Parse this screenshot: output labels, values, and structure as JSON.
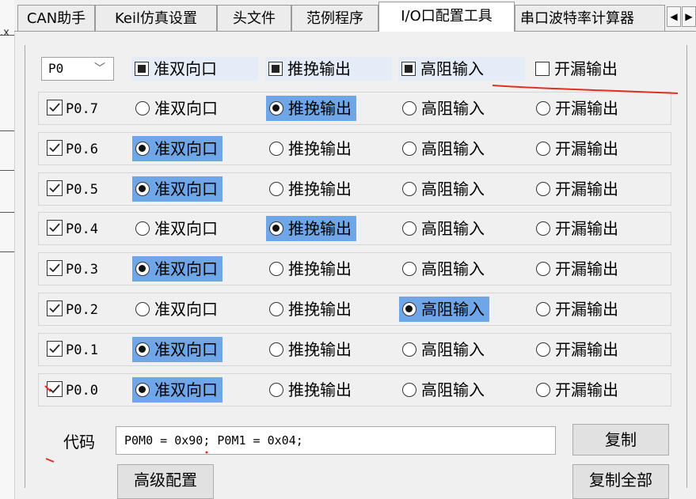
{
  "left_edge": {
    "fragment": ".x"
  },
  "tabs": [
    {
      "label": "CAN助手",
      "active": false
    },
    {
      "label": "Keil仿真设置",
      "active": false
    },
    {
      "label": "头文件",
      "active": false
    },
    {
      "label": "范例程序",
      "active": false
    },
    {
      "label": "I/O口配置工具",
      "active": true
    },
    {
      "label": "串口波特率计算器",
      "active": false
    }
  ],
  "tab_scroll": {
    "left_icon": "◀",
    "right_icon": "▶"
  },
  "port": {
    "selected": "P0",
    "dropdown_icon": "chevron-down-icon"
  },
  "mode_labels": [
    "准双向口",
    "推挽输出",
    "高阻输入",
    "开漏输出"
  ],
  "header_modes": [
    {
      "label": "准双向口",
      "state": "partial"
    },
    {
      "label": "推挽输出",
      "state": "partial"
    },
    {
      "label": "高阻输入",
      "state": "partial"
    },
    {
      "label": "开漏输出",
      "state": "unchecked"
    }
  ],
  "pins": [
    {
      "label": "P0.7",
      "checked": true,
      "mode": 1
    },
    {
      "label": "P0.6",
      "checked": true,
      "mode": 0
    },
    {
      "label": "P0.5",
      "checked": true,
      "mode": 0
    },
    {
      "label": "P0.4",
      "checked": true,
      "mode": 1
    },
    {
      "label": "P0.3",
      "checked": true,
      "mode": 0
    },
    {
      "label": "P0.2",
      "checked": true,
      "mode": 2
    },
    {
      "label": "P0.1",
      "checked": true,
      "mode": 0
    },
    {
      "label": "P0.0",
      "checked": true,
      "mode": 0
    }
  ],
  "code": {
    "label": "代码",
    "value": "P0M0 = 0x90; P0M1 = 0x04;"
  },
  "buttons": {
    "copy": "复制",
    "advanced": "高级配置",
    "copy_all": "复制全部"
  },
  "colors": {
    "selected_bg": "#6fa6e8",
    "header_bg": "#e3ecf7",
    "annotation": "#e03020"
  }
}
